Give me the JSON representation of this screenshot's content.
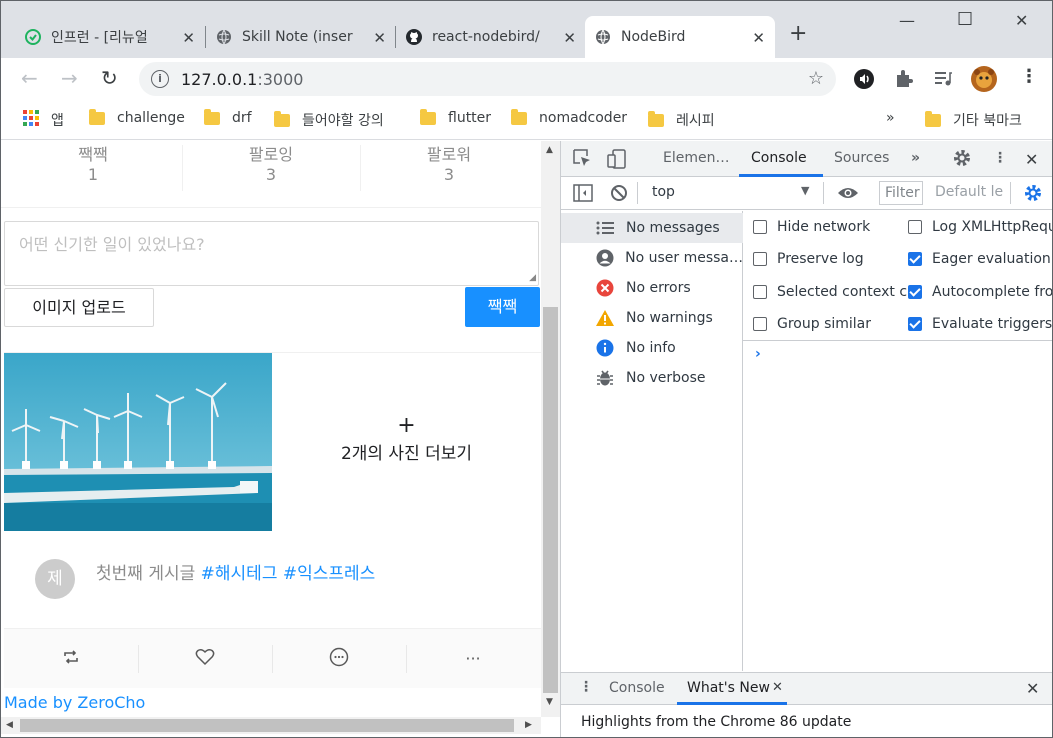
{
  "browser": {
    "tabs": [
      {
        "title": "인프런 - [리뉴얼",
        "icon": "inflearn-icon"
      },
      {
        "title": "Skill Note (inser",
        "icon": "globe-icon"
      },
      {
        "title": "react-nodebird/",
        "icon": "github-icon"
      },
      {
        "title": "NodeBird",
        "icon": "globe-icon",
        "active": true
      }
    ],
    "url_host": "127.0.0.1",
    "url_port": ":3000",
    "bookmarks": {
      "apps": "앱",
      "folders": [
        "challenge",
        "drf",
        "들어야할 강의",
        "flutter",
        "nomadcoder",
        "레시피"
      ],
      "overflow": "»",
      "other": "기타 북마크"
    }
  },
  "page": {
    "stats": [
      {
        "label": "짹짹",
        "value": "1"
      },
      {
        "label": "팔로잉",
        "value": "3"
      },
      {
        "label": "팔로워",
        "value": "3"
      }
    ],
    "post_placeholder": "어떤 신기한 일이 있었나요?",
    "upload_label": "이미지 업로드",
    "submit_label": "짹짹",
    "more_photos": "2개의 사진 더보기",
    "more_plus": "+",
    "avatar_initial": "제",
    "post_text": "첫번째 게시글 ",
    "hashtags": [
      "#해시테그",
      "#익스프레스"
    ],
    "more_dots": "···",
    "footer": "Made by ZeroCho",
    "colors": {
      "primary": "#1890ff",
      "muted": "#8c8c8c"
    }
  },
  "devtools": {
    "tabs": [
      "Elemen…",
      "Console",
      "Sources"
    ],
    "active_tab": "Console",
    "overflow": "»",
    "context": "top",
    "filter_placeholder": "Filter",
    "levels": "Default le",
    "sidebar": [
      {
        "label": "No messages",
        "icon": "list-icon",
        "selected": true
      },
      {
        "label": "No user messa…",
        "icon": "user-icon"
      },
      {
        "label": "No errors",
        "icon": "error-icon"
      },
      {
        "label": "No warnings",
        "icon": "warning-icon"
      },
      {
        "label": "No info",
        "icon": "info-icon"
      },
      {
        "label": "No verbose",
        "icon": "bug-icon"
      }
    ],
    "settings": [
      {
        "label": "Hide network",
        "checked": false
      },
      {
        "label": "Log XMLHttpRequ",
        "checked": false
      },
      {
        "label": "Preserve log",
        "checked": false
      },
      {
        "label": "Eager evaluation",
        "checked": true
      },
      {
        "label": "Selected context c",
        "checked": false
      },
      {
        "label": "Autocomplete fror",
        "checked": true
      },
      {
        "label": "Group similar",
        "checked": false
      },
      {
        "label": "Evaluate triggers u",
        "checked": true
      }
    ],
    "prompt": "›",
    "drawer_tabs": [
      "Console",
      "What's New"
    ],
    "drawer_message": "Highlights from the Chrome 86 update"
  }
}
